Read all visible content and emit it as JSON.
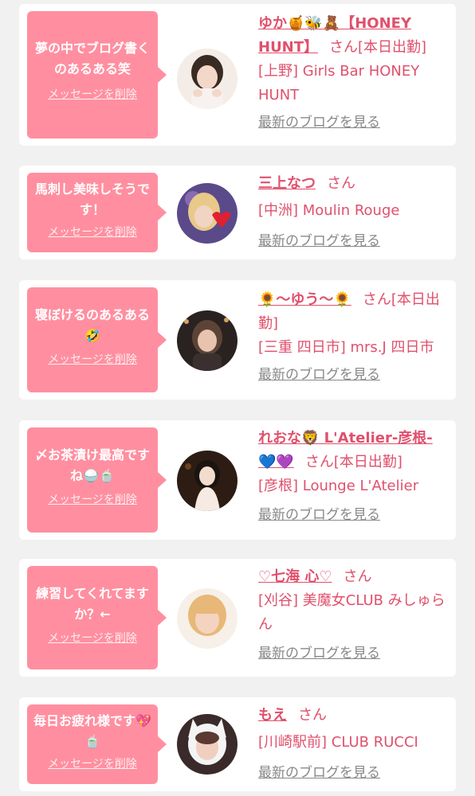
{
  "colors": {
    "accent": "#e0506c",
    "bubble": "#ff8fa0",
    "background": "#f1f1f1",
    "link_gray": "#888888"
  },
  "cards": [
    {
      "message": "夢の中でブログ書くのあるある笑",
      "delete_label": "メッセージを削除",
      "name": "ゆか🍯🐝🧸【HONEY HUNT】",
      "san": "さん",
      "status": "[本日出勤]",
      "shop": "[上野] Girls Bar HONEY HUNT",
      "blog_label": "最新のブログを見る",
      "avatar_palette": [
        "#f4ece6",
        "#3a2a24",
        "#f3d7c8"
      ]
    },
    {
      "message": "馬刺し美味しそうです！",
      "delete_label": "メッセージを削除",
      "name": "三上なつ",
      "san": "さん",
      "status": "",
      "shop": "[中洲] Moulin Rouge",
      "blog_label": "最新のブログを見る",
      "avatar_palette": [
        "#5a4a8a",
        "#e8c98a",
        "#e02030"
      ]
    },
    {
      "message": "寝ぼけるのあるある🤣",
      "delete_label": "メッセージを削除",
      "name": "🌻〜ゆう〜🌻",
      "san": "さん",
      "status": "[本日出勤]",
      "shop": "[三重 四日市] mrs.J 四日市",
      "blog_label": "最新のブログを見る",
      "avatar_palette": [
        "#2a2220",
        "#5b4436",
        "#e8c3ae"
      ]
    },
    {
      "message": "〆お茶漬け最高ですね🍚🍵",
      "delete_label": "メッセージを削除",
      "name": "れおな🦁 L'Atelier-彦根-💙💜",
      "san": "さん",
      "status": "[本日出勤]",
      "shop": "[彦根] Lounge L'Atelier",
      "blog_label": "最新のブログを見る",
      "avatar_palette": [
        "#2c1c14",
        "#1a1410",
        "#f2dccc"
      ]
    },
    {
      "message": "練習してくれてますか？←",
      "delete_label": "メッセージを削除",
      "name": "♡七海 心♡",
      "san": "さん",
      "status": "",
      "shop": "[刈谷] 美魔女CLUB みしゅらん",
      "blog_label": "最新のブログを見る",
      "avatar_palette": [
        "#f7f0e8",
        "#e8b878",
        "#f4d4c0"
      ]
    },
    {
      "message": "毎日お疲れ様です💖🍵",
      "delete_label": "メッセージを削除",
      "name": "もえ",
      "san": "さん",
      "status": "",
      "shop": "[川崎駅前] CLUB RUCCI",
      "blog_label": "最新のブログを見る",
      "avatar_palette": [
        "#3a2a2a",
        "#f4f4f4",
        "#f0cfc0"
      ]
    }
  ]
}
